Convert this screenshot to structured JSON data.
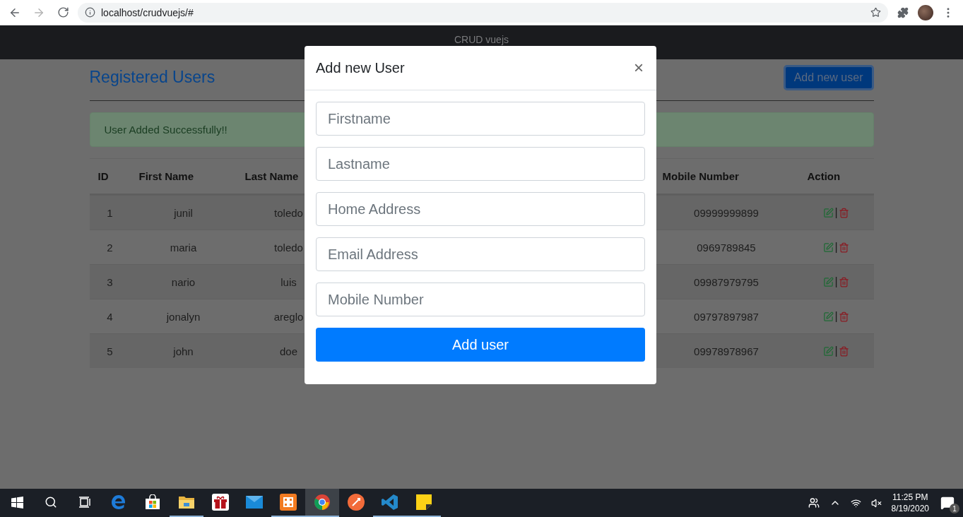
{
  "browser": {
    "url": "localhost/crudvuejs/#",
    "back_disabled": false,
    "forward_disabled": true
  },
  "navbar": {
    "title": "CRUD vuejs"
  },
  "page": {
    "heading": "Registered Users",
    "add_button": "Add new user",
    "alert": "User Added Successfully!!"
  },
  "table": {
    "columns": [
      "ID",
      "First Name",
      "Last Name",
      "Mobile Number",
      "Action"
    ],
    "rows": [
      {
        "id": "1",
        "first_name": "junil",
        "last_name": "toledo",
        "mobile": "09999999899",
        "separator": "|"
      },
      {
        "id": "2",
        "first_name": "maria",
        "last_name": "toledo",
        "mobile": "0969789845",
        "separator": "|"
      },
      {
        "id": "3",
        "first_name": "nario",
        "last_name": "luis",
        "mobile": "09987979795",
        "separator": "|"
      },
      {
        "id": "4",
        "first_name": "jonalyn",
        "last_name": "areglo",
        "mobile": "09797897987",
        "separator": "|"
      },
      {
        "id": "5",
        "first_name": "john",
        "last_name": "doe",
        "mobile": "09978978967",
        "separator": "|"
      }
    ]
  },
  "modal": {
    "title": "Add new User",
    "close": "×",
    "fields": [
      {
        "placeholder": "Firstname"
      },
      {
        "placeholder": "Lastname"
      },
      {
        "placeholder": "Home Address"
      },
      {
        "placeholder": "Email Address"
      },
      {
        "placeholder": "Mobile Number"
      }
    ],
    "submit": "Add user"
  },
  "taskbar": {
    "apps": [
      {
        "kind": "start",
        "running": false,
        "selected": false
      },
      {
        "kind": "search",
        "running": false,
        "selected": false
      },
      {
        "kind": "taskview",
        "running": false,
        "selected": false
      },
      {
        "kind": "edge",
        "running": false,
        "selected": false
      },
      {
        "kind": "store",
        "running": false,
        "selected": false
      },
      {
        "kind": "folder",
        "running": true,
        "selected": false
      },
      {
        "kind": "gift",
        "running": false,
        "selected": false
      },
      {
        "kind": "mail",
        "running": false,
        "selected": false
      },
      {
        "kind": "xampp",
        "running": true,
        "selected": false
      },
      {
        "kind": "chrome",
        "running": true,
        "selected": true
      },
      {
        "kind": "postman",
        "running": false,
        "selected": false
      },
      {
        "kind": "vscode",
        "running": true,
        "selected": false
      },
      {
        "kind": "notes",
        "running": true,
        "selected": false
      }
    ],
    "time": "11:25 PM",
    "date": "8/19/2020",
    "notifications": "1"
  }
}
